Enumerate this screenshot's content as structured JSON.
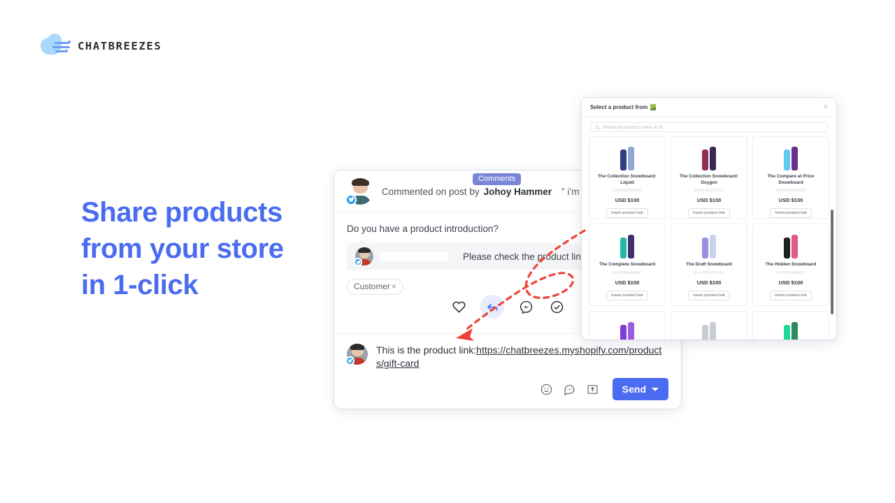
{
  "brand": {
    "name": "CHATBREEZES",
    "logo_icon": "cloud-wind-icon",
    "accent_color": "#4a6cf0",
    "logo_cloud_color": "#a9d8fb"
  },
  "headline": {
    "line1": "Share products",
    "line2": "from your store",
    "line3": "in 1-click",
    "color": "#4a6cf0"
  },
  "conversation": {
    "badge": "Comments",
    "badge_color": "#7b85d6",
    "header_prefix": "Commented on post by",
    "author": "Johoy Hammer",
    "quote": "” i’m so beaut",
    "question": "Do you have a product introduction?",
    "bubble_text": "Please check the product link below",
    "chip_label": "Customer",
    "chip_close": "×",
    "actions": [
      {
        "name": "heart-icon",
        "label": "Like"
      },
      {
        "name": "reply-icon",
        "label": "Reply",
        "active": true
      },
      {
        "name": "messenger-icon",
        "label": "Messenger"
      },
      {
        "name": "check-circle-icon",
        "label": "Done"
      }
    ],
    "reply_prefix": "This is the product link:",
    "reply_link": "https://chatbreezes.myshopify.com/products/gift-card",
    "compose_icons": [
      "emoji-icon",
      "quick-reply-icon",
      "upload-folder-icon"
    ],
    "send_label": "Send",
    "send_color": "#4a6cf0"
  },
  "product_modal": {
    "title": "Select a product from",
    "title_icon": "shopify-icon",
    "close": "×",
    "search_placeholder": "Search by product name or ID",
    "search_icon": "search-icon",
    "insert_label": "Insert product link",
    "products": [
      {
        "name": "The Collection Snowboard: Liquid",
        "id": "ID:8635805401367",
        "price": "USD $100",
        "colors": [
          "#2d3f7c",
          "#8fa7d8"
        ]
      },
      {
        "name": "The Collection Snowboard: Oxygen",
        "id": "ID:8635805237527",
        "price": "USD $100",
        "colors": [
          "#8e2f55",
          "#3a2a52"
        ]
      },
      {
        "name": "The Compare at Price Snowboard",
        "id": "ID:8635805040215",
        "price": "USD $100",
        "colors": [
          "#5fc9f0",
          "#6a2f8a"
        ]
      },
      {
        "name": "The Complete Snowboard",
        "id": "ID:8635804909847",
        "price": "USD $100",
        "colors": [
          "#22b8a6",
          "#3e2f6e"
        ]
      },
      {
        "name": "The Draft Snowboard",
        "id": "ID:8635805008151",
        "price": "USD $100",
        "colors": [
          "#9b8fe0",
          "#c9d3f0"
        ]
      },
      {
        "name": "The Hidden Snowboard",
        "id": "ID:8635804844311",
        "price": "USD $100",
        "colors": [
          "#1d1d22",
          "#e05a8a"
        ]
      },
      {
        "name": "",
        "id": "",
        "price": "",
        "colors": [
          "#7b3fd4",
          "#9b5ce0"
        ]
      },
      {
        "name": "",
        "id": "",
        "price": "",
        "colors": [
          "#c8ccd4",
          "#c8ccd4"
        ]
      },
      {
        "name": "",
        "id": "",
        "price": "",
        "colors": [
          "#1ed99a",
          "#2f8a5e"
        ]
      }
    ]
  },
  "annotation": {
    "arrow_color": "#ef4136",
    "style": "dashed-curve-arrow"
  }
}
